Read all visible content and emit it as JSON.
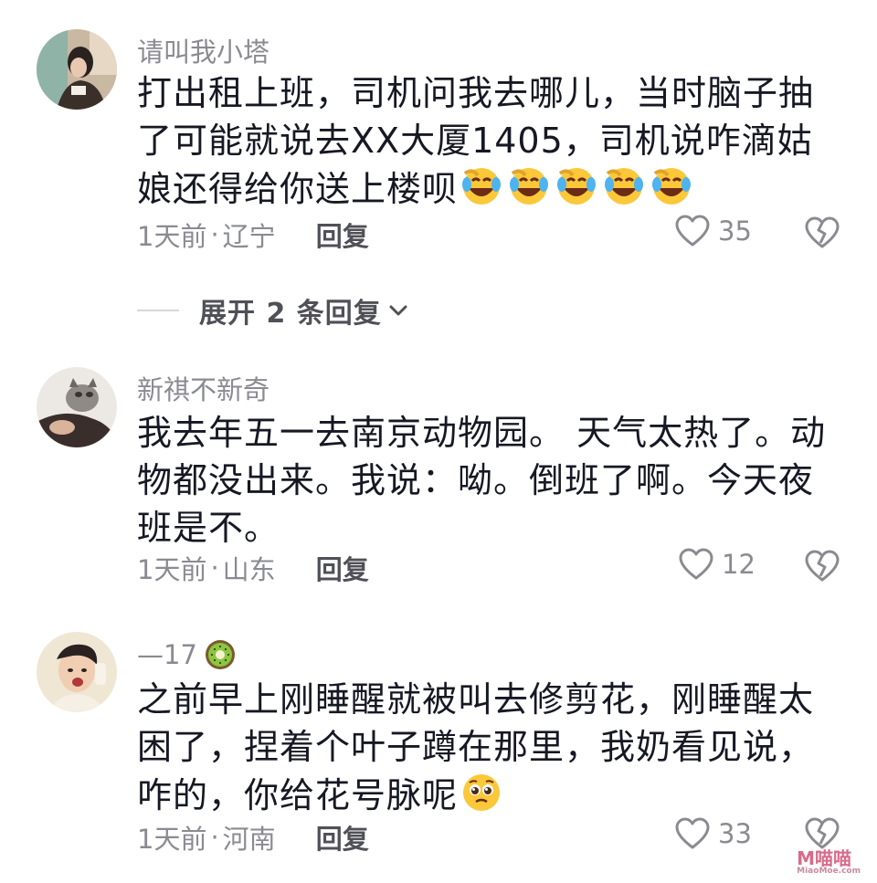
{
  "comments": [
    {
      "username": "请叫我小塔",
      "text": "打出租上班，司机问我去哪儿，当时脑子抽了可能就说去XX大厦1405，司机说咋滴姑娘还得给你送上楼呗",
      "trailing_emojis": [
        "rofl-emoji",
        "rofl-emoji",
        "rofl-emoji",
        "rofl-emoji",
        "rofl-emoji"
      ],
      "time": "1天前",
      "location": "辽宁",
      "reply_label": "回复",
      "likes": "35"
    },
    {
      "username": "新祺不新奇",
      "text": "我去年五一去南京动物园。 天气太热了。动物都没出来。我说：呦。倒班了啊。今天夜班是不。",
      "time": "1天前",
      "location": "山东",
      "reply_label": "回复",
      "likes": "12"
    },
    {
      "username": "—17",
      "username_emoji": "kiwi-emoji",
      "text": "之前早上刚睡醒就被叫去修剪花，刚睡醒太困了，捏着个叶子蹲在那里，我奶看见说，咋的，你给花号脉呢",
      "trailing_emojis": [
        "pleading-face-emoji"
      ],
      "time": "1天前",
      "location": "河南",
      "reply_label": "回复",
      "likes": "33"
    }
  ],
  "expand_replies": {
    "label": "展开 2 条回复"
  },
  "meta_separator": "·",
  "watermark": {
    "text": "M喵喵",
    "sub": "MiaoMoe.com"
  },
  "colors": {
    "text_primary": "#161823",
    "text_secondary": "#8a8b91",
    "reply": "#505157",
    "background": "#ffffff"
  }
}
